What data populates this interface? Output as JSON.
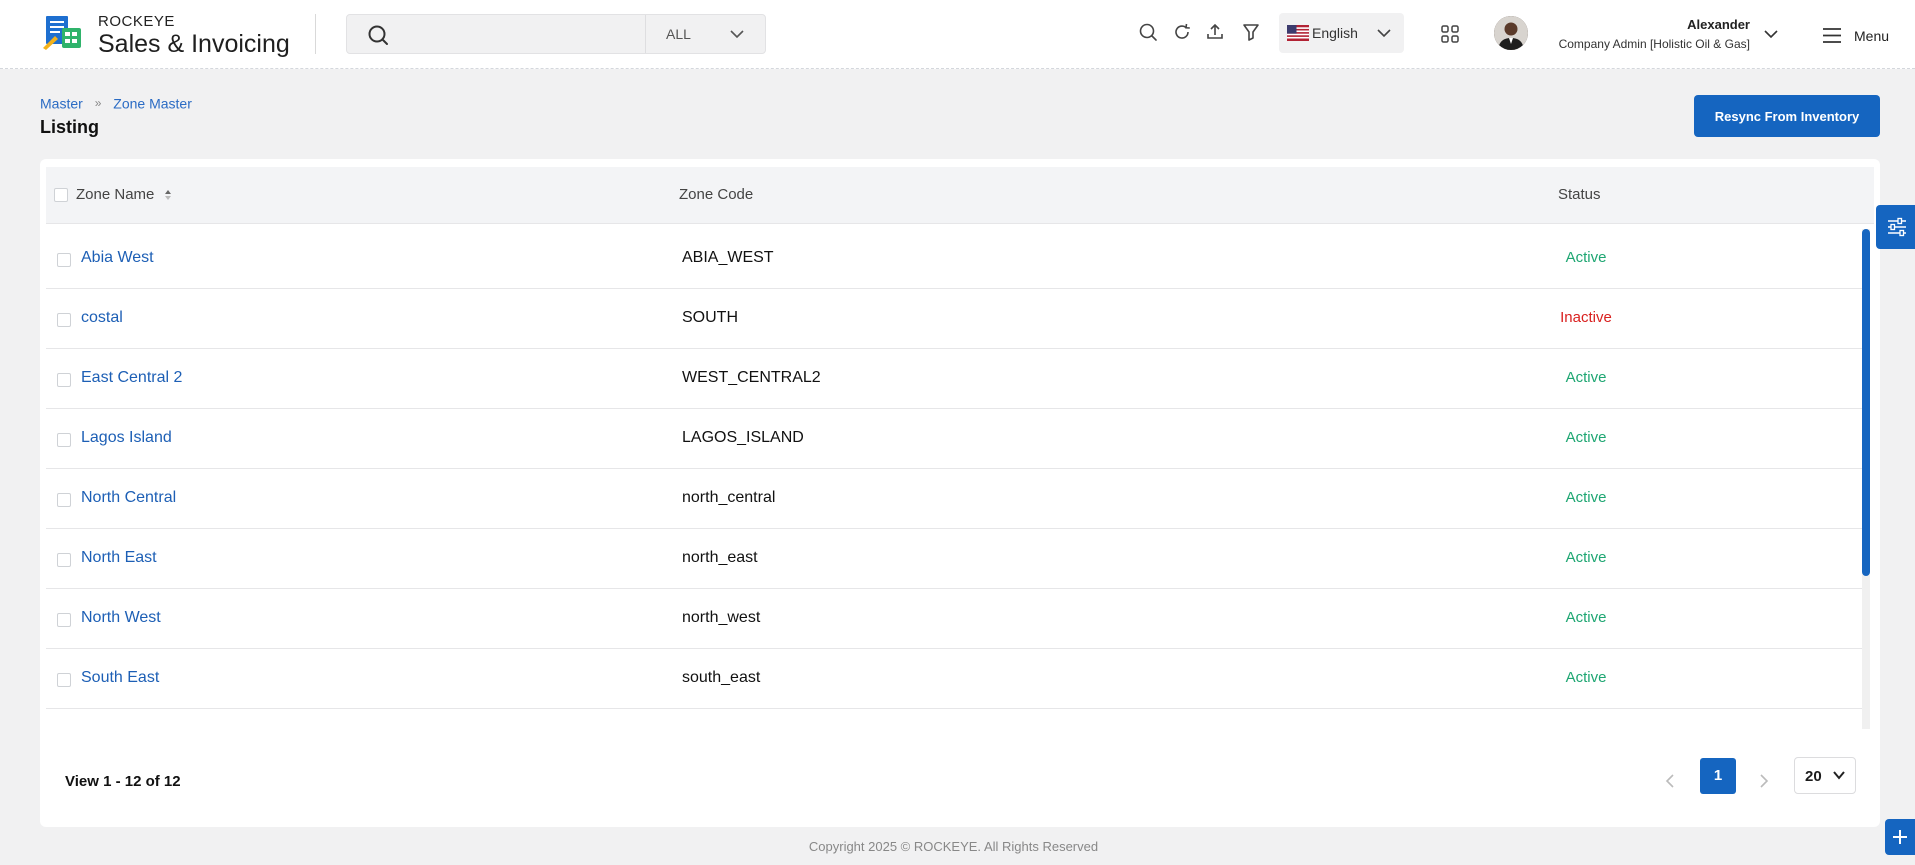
{
  "app": {
    "brand_top": "ROCKEYE",
    "brand_bottom": "Sales & Invoicing"
  },
  "search": {
    "placeholder": "",
    "scope": "ALL"
  },
  "language": {
    "label": "English",
    "flag": "us-flag-icon"
  },
  "user": {
    "name": "Alexander",
    "role": "Company Admin [Holistic Oil & Gas]"
  },
  "menu_label": "Menu",
  "breadcrumb": [
    "Master",
    "Zone Master"
  ],
  "page_title": "Listing",
  "resync_label": "Resync From Inventory",
  "table": {
    "headers": [
      "Zone Name",
      "Zone Code",
      "Status"
    ],
    "rows": [
      {
        "name": "Abia West",
        "code": "ABIA_WEST",
        "status": "Active"
      },
      {
        "name": "costal",
        "code": "SOUTH",
        "status": "Inactive"
      },
      {
        "name": "East Central 2",
        "code": "WEST_CENTRAL2",
        "status": "Active"
      },
      {
        "name": "Lagos Island",
        "code": "LAGOS_ISLAND",
        "status": "Active"
      },
      {
        "name": "North Central",
        "code": "north_central",
        "status": "Active"
      },
      {
        "name": "North East",
        "code": "north_east",
        "status": "Active"
      },
      {
        "name": "North West",
        "code": "north_west",
        "status": "Active"
      },
      {
        "name": "South East",
        "code": "south_east",
        "status": "Active"
      }
    ]
  },
  "pagination": {
    "view_text": "View 1 - 12 of 12",
    "current_page": "1",
    "page_size": "20"
  },
  "footer": "Copyright 2025 © ROCKEYE. All Rights Reserved",
  "colors": {
    "primary": "#1565c0",
    "link": "#1d5fb5",
    "active": "#1ea672",
    "inactive": "#d9201f"
  }
}
